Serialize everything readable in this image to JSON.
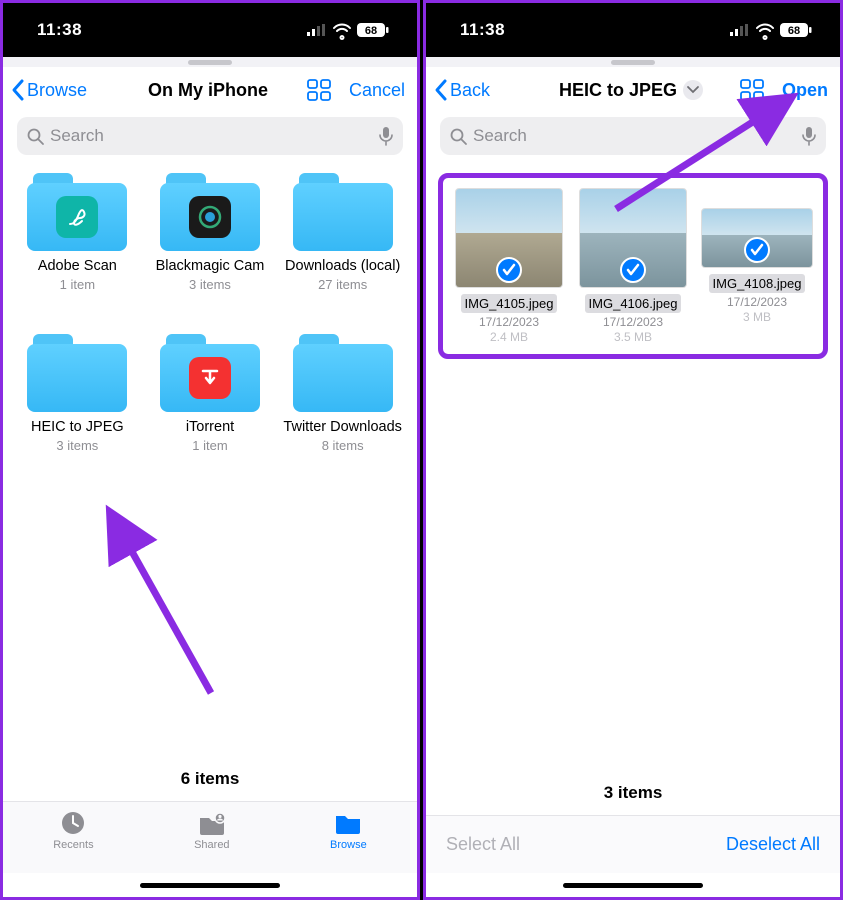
{
  "left": {
    "status": {
      "time": "11:38",
      "battery": "68"
    },
    "nav": {
      "back": "Browse",
      "title": "On My iPhone",
      "action": "Cancel"
    },
    "search_placeholder": "Search",
    "folders": [
      {
        "name": "Adobe Scan",
        "meta": "1 item",
        "icon": "adobe"
      },
      {
        "name": "Blackmagic Cam",
        "meta": "3 items",
        "icon": "bmcam"
      },
      {
        "name": "Downloads (local)",
        "meta": "27 items",
        "icon": ""
      },
      {
        "name": "HEIC to JPEG",
        "meta": "3 items",
        "icon": ""
      },
      {
        "name": "iTorrent",
        "meta": "1 item",
        "icon": "itorrent"
      },
      {
        "name": "Twitter Downloads",
        "meta": "8 items",
        "icon": ""
      }
    ],
    "count": "6 items",
    "tabs": {
      "recents": "Recents",
      "shared": "Shared",
      "browse": "Browse"
    }
  },
  "right": {
    "status": {
      "time": "11:38",
      "battery": "68"
    },
    "nav": {
      "back": "Back",
      "title": "HEIC to JPEG",
      "action": "Open"
    },
    "search_placeholder": "Search",
    "files": [
      {
        "name": "IMG_4105.jpeg",
        "date": "17/12/2023",
        "size": "2.4 MB"
      },
      {
        "name": "IMG_4106.jpeg",
        "date": "17/12/2023",
        "size": "3.5 MB"
      },
      {
        "name": "IMG_4108.jpeg",
        "date": "17/12/2023",
        "size": "3 MB"
      }
    ],
    "count": "3 items",
    "toolbar": {
      "select_all": "Select All",
      "deselect_all": "Deselect All"
    }
  }
}
